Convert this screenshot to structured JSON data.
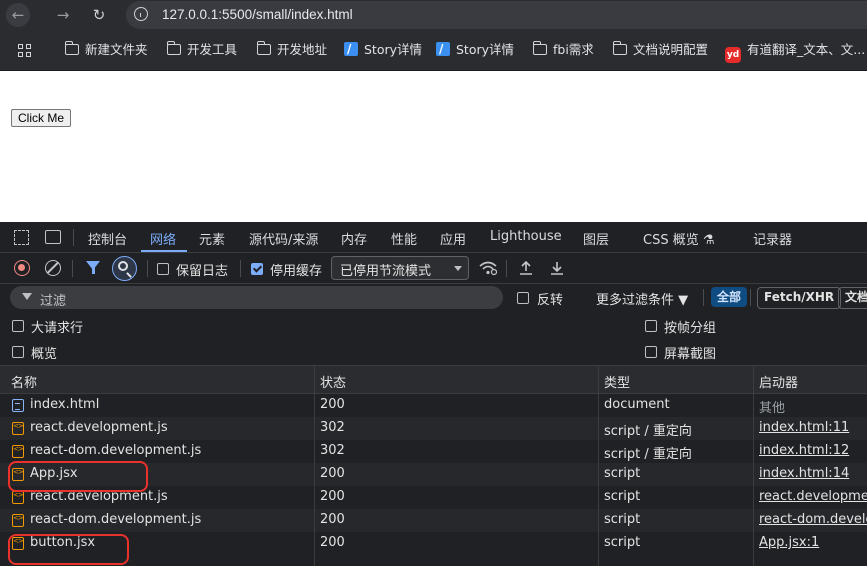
{
  "browser": {
    "url": "127.0.0.1:5500/small/index.html",
    "nav": {
      "back_icon": "←",
      "forward_icon": "→",
      "reload_icon": "↻"
    }
  },
  "bookmarks": [
    {
      "label": "新建文件夹",
      "icon": "folder-icon"
    },
    {
      "label": "开发工具",
      "icon": "folder-icon"
    },
    {
      "label": "开发地址",
      "icon": "folder-icon"
    },
    {
      "label": "Story详情",
      "icon": "story-icon"
    },
    {
      "label": "Story详情",
      "icon": "story-icon"
    },
    {
      "label": "fbi需求",
      "icon": "folder-icon"
    },
    {
      "label": "文档说明配置",
      "icon": "folder-icon"
    },
    {
      "label": "有道翻译_文本、文...",
      "icon": "youdao-icon",
      "icon_text": "yd"
    }
  ],
  "page": {
    "button_label": "Click Me"
  },
  "devtools": {
    "tabs": [
      "控制台",
      "网络",
      "元素",
      "源代码/来源",
      "内存",
      "性能",
      "应用",
      "Lighthouse",
      "图层",
      "CSS 概览 ⚗",
      "记录器"
    ],
    "active_tab": "网络",
    "toolbar": {
      "preserve_log": "保留日志",
      "disable_cache": "停用缓存",
      "throttle": "已停用节流模式"
    },
    "filter": {
      "placeholder": "过滤",
      "invert": "反转",
      "more_filters": "更多过滤条件 ▼",
      "all": "全部",
      "fetch_xhr": "Fetch/XHR",
      "doc": "文档"
    },
    "options": {
      "large_rows": "大请求行",
      "overview": "概览",
      "group_by_frame": "按帧分组",
      "screenshots": "屏幕截图"
    },
    "columns": [
      "名称",
      "状态",
      "类型",
      "启动器"
    ],
    "requests": [
      {
        "name": "index.html",
        "status": "200",
        "type": "document",
        "initiator": "其他",
        "kind": "doc",
        "initiator_link": false
      },
      {
        "name": "react.development.js",
        "status": "302",
        "type": "script / 重定向",
        "initiator": "index.html:11",
        "kind": "script",
        "initiator_link": true
      },
      {
        "name": "react-dom.development.js",
        "status": "302",
        "type": "script / 重定向",
        "initiator": "index.html:12",
        "kind": "script",
        "initiator_link": true
      },
      {
        "name": "App.jsx",
        "status": "200",
        "type": "script",
        "initiator": "index.html:14",
        "kind": "script",
        "initiator_link": true
      },
      {
        "name": "react.development.js",
        "status": "200",
        "type": "script",
        "initiator": "react.development",
        "kind": "script",
        "initiator_link": true
      },
      {
        "name": "react-dom.development.js",
        "status": "200",
        "type": "script",
        "initiator": "react-dom.develo",
        "kind": "script",
        "initiator_link": true
      },
      {
        "name": "button.jsx",
        "status": "200",
        "type": "script",
        "initiator": "App.jsx:1",
        "kind": "script",
        "initiator_link": true
      }
    ]
  },
  "colors": {
    "accent": "#7cacf8",
    "annotation": "#e8322b"
  }
}
